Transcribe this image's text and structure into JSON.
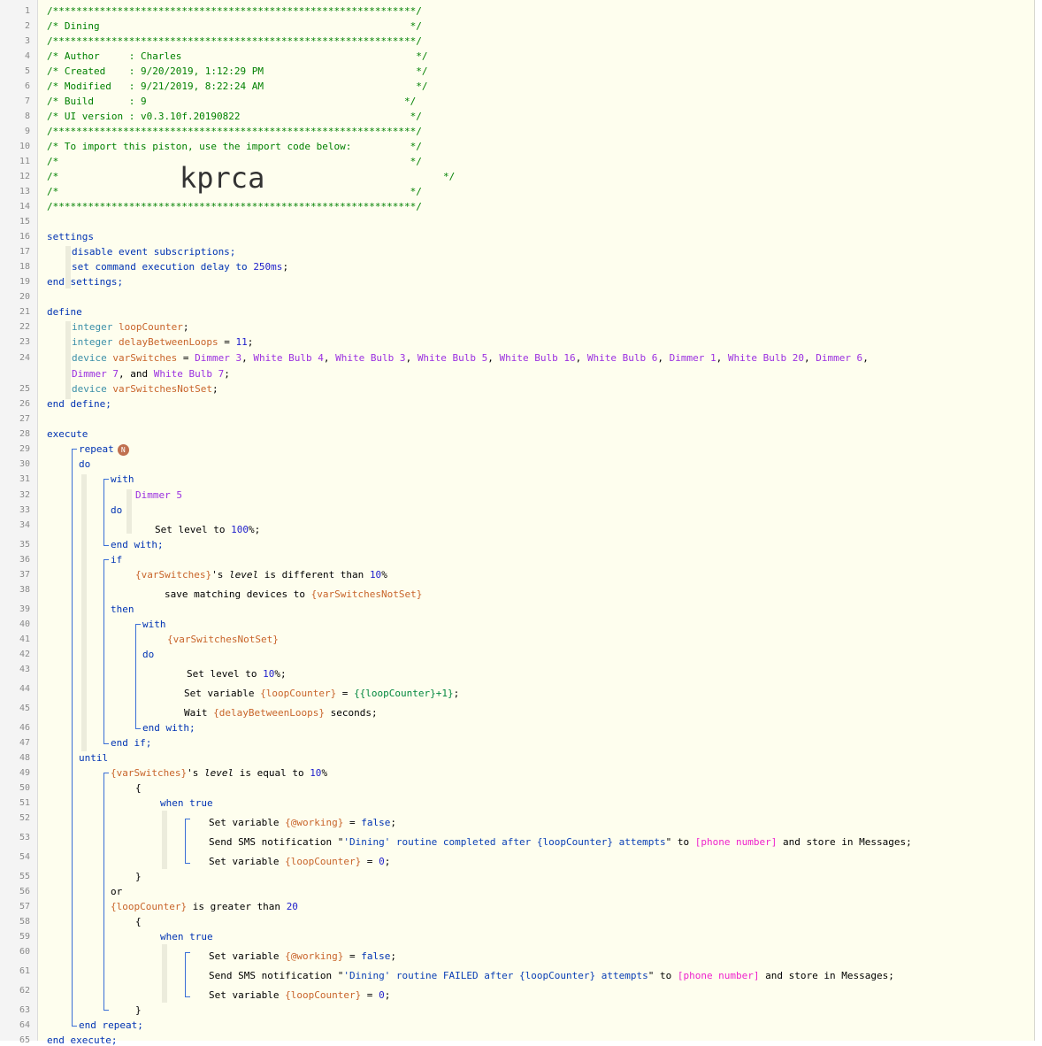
{
  "line_numbers": [
    "1",
    "2",
    "3",
    "4",
    "5",
    "6",
    "7",
    "8",
    "9",
    "10",
    "11",
    "12",
    "13",
    "14",
    "15",
    "16",
    "17",
    "18",
    "19",
    "20",
    "21",
    "22",
    "23",
    "24",
    "25",
    "26",
    "27",
    "28",
    "29",
    "30",
    "31",
    "32",
    "33",
    "34",
    "35",
    "36",
    "37",
    "38",
    "39",
    "40",
    "41",
    "42",
    "43",
    "44",
    "45",
    "46",
    "47",
    "48",
    "49",
    "50",
    "51",
    "52",
    "53",
    "54",
    "55",
    "56",
    "57",
    "58",
    "59",
    "60",
    "61",
    "62",
    "63",
    "64",
    "65"
  ],
  "header": {
    "border": "/**************************************************************/",
    "title_line": "/* Dining                                                     */",
    "author_line": "/* Author     : Charles                                        */",
    "created_line": "/* Created    : 9/20/2019, 1:12:29 PM                          */",
    "modified_line": "/* Modified   : 9/21/2019, 8:22:24 AM                          */",
    "build_line": "/* Build      : 9                                            */",
    "ui_line": "/* UI version : v0.3.10f.20190822                             */",
    "import_line": "/* To import this piston, use the import code below:          */",
    "blank_line": "/*                                                            */",
    "code_prefix": "/*",
    "code_suffix": "*/",
    "import_code": "kprca"
  },
  "settings": {
    "open": "settings",
    "line1": "disable event subscriptions;",
    "line2_a": "set command execution delay to ",
    "line2_b": "250ms",
    "line2_c": ";",
    "close": "end settings;"
  },
  "define": {
    "open": "define",
    "type_integer": "integer",
    "type_device": "device",
    "var_loop": "loopCounter",
    "var_delay": "delayBetweenLoops",
    "delay_value": "11",
    "var_switches": "varSwitches",
    "devices": [
      "Dimmer 3",
      "White Bulb 4",
      "White Bulb 3",
      "White Bulb 5",
      "White Bulb 16",
      "White Bulb 6",
      "Dimmer 1",
      "White Bulb 20",
      "Dimmer 6",
      "Dimmer 7",
      "White Bulb 7"
    ],
    "and_word": "and",
    "var_notset": "varSwitchesNotSet",
    "close": "end define;"
  },
  "execute": {
    "open": "execute",
    "repeat": "repeat",
    "repeat_badge": "N",
    "do": "do",
    "with": "with",
    "dimmer5": "Dimmer 5",
    "set_level_100_a": "Set level to ",
    "set_level_100_b": "100",
    "pct_semi": "%;",
    "end_with": "end with;",
    "if": "if",
    "cond1_var": "{varSwitches}",
    "cond1_mid": "'s ",
    "attr_level": "level",
    "cond1_op": " is different than ",
    "val_10": "10",
    "pct": "%",
    "save_matching": "save matching devices to ",
    "notset_ref": "{varSwitchesNotSet}",
    "then": "then",
    "set_level_10_a": "Set level to ",
    "set_var_label": "Set variable ",
    "loop_ref": "{loopCounter}",
    "eq": " = ",
    "loop_expr": "{{loopCounter}+1}",
    "semi": ";",
    "wait_a": "Wait ",
    "delay_ref": "{delayBetweenLoops}",
    "wait_b": " seconds;",
    "end_if": "end if;",
    "until": "until",
    "cond2_op": " is equal to ",
    "brace_open": "{",
    "brace_close": "}",
    "when_true": "when true",
    "working_ref": "{@working}",
    "false_val": "false",
    "sms_a": "Send SMS notification \"",
    "sms1_text": "'Dining' routine completed after {loopCounter} attempts",
    "sms2_text": "'Dining' routine FAILED after {loopCounter} attempts",
    "sms_b": "\" to ",
    "phone": "[phone number]",
    "sms_c": " and store in Messages;",
    "zero_val": "0",
    "or": "or",
    "cond3_op": " is greater than ",
    "val_20": "20",
    "end_repeat": "end repeat;",
    "close": "end execute;"
  }
}
